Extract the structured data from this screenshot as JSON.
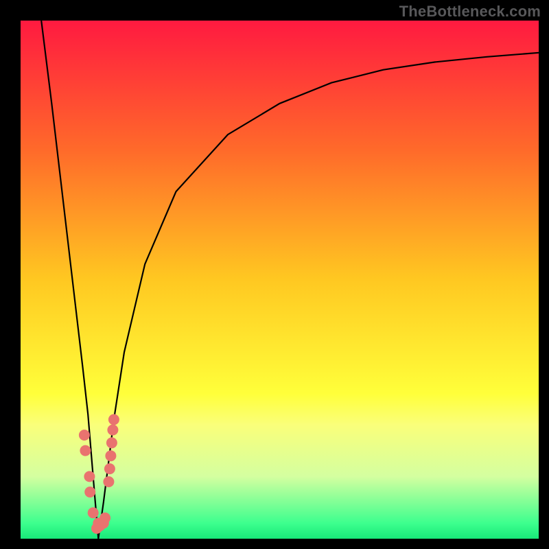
{
  "watermark": "TheBottleneck.com",
  "chart_data": {
    "type": "line",
    "title": "",
    "xlabel": "",
    "ylabel": "",
    "xlim": [
      0,
      100
    ],
    "ylim": [
      0,
      100
    ],
    "grid": false,
    "legend": false,
    "background_gradient": {
      "type": "vertical",
      "stops": [
        {
          "pos": 0.0,
          "color": "#ff1a40"
        },
        {
          "pos": 0.25,
          "color": "#ff6a2a"
        },
        {
          "pos": 0.5,
          "color": "#ffc821"
        },
        {
          "pos": 0.72,
          "color": "#ffff3a"
        },
        {
          "pos": 0.78,
          "color": "#faff7a"
        },
        {
          "pos": 0.88,
          "color": "#d4ffa0"
        },
        {
          "pos": 0.97,
          "color": "#3dff8e"
        },
        {
          "pos": 1.0,
          "color": "#18e879"
        }
      ]
    },
    "series": [
      {
        "name": "bottleneck-curve",
        "note": "Two branches meeting at a sharp minimum near x≈15, y≈0; y estimated from plot since axes are unlabeled.",
        "x": [
          4,
          6,
          8,
          10,
          12,
          13,
          14,
          15,
          16,
          17,
          18,
          20,
          24,
          30,
          40,
          50,
          60,
          70,
          80,
          90,
          100
        ],
        "y": [
          100,
          84,
          67,
          50,
          33,
          24,
          12,
          0,
          7,
          15,
          23,
          36,
          53,
          67,
          78,
          84,
          88,
          90.5,
          92,
          93,
          93.8
        ]
      }
    ],
    "markers": {
      "name": "gpu-dots",
      "note": "Clustered salmon-colored dots along the lower part of both branches near the minimum.",
      "points": [
        {
          "x": 12.3,
          "y": 20.0
        },
        {
          "x": 12.5,
          "y": 17.0
        },
        {
          "x": 13.3,
          "y": 12.0
        },
        {
          "x": 13.4,
          "y": 9.0
        },
        {
          "x": 14.0,
          "y": 5.0
        },
        {
          "x": 14.7,
          "y": 2.0
        },
        {
          "x": 15.0,
          "y": 3.0
        },
        {
          "x": 15.3,
          "y": 2.5
        },
        {
          "x": 16.0,
          "y": 3.0
        },
        {
          "x": 16.3,
          "y": 4.0
        },
        {
          "x": 17.0,
          "y": 11.0
        },
        {
          "x": 17.2,
          "y": 13.5
        },
        {
          "x": 17.4,
          "y": 16.0
        },
        {
          "x": 17.6,
          "y": 18.5
        },
        {
          "x": 17.8,
          "y": 21.0
        },
        {
          "x": 18.0,
          "y": 23.0
        }
      ],
      "color": "#e9736f",
      "radius": 8
    }
  }
}
